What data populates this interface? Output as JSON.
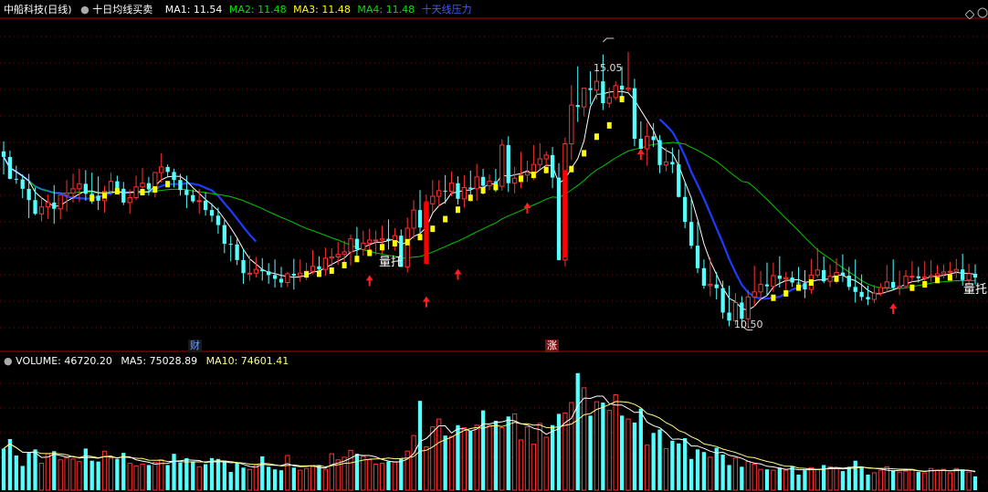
{
  "header": {
    "stock_name": "中船科技",
    "period": "(日线)",
    "indicator_name": "十日均线买卖",
    "ma1": "MA1: 11.54",
    "ma2": "MA2: 11.48",
    "ma3": "MA3: 11.48",
    "ma4": "MA4: 11.48",
    "pressure_label": "十天线压力"
  },
  "volume_header": {
    "volume": "VOLUME: 46720.20",
    "ma5": "MA5: 75028.89",
    "ma10": "MA10: 74601.41"
  },
  "markers": {
    "cai": "财",
    "zhang": "涨",
    "liangtuo_1": "量托",
    "liangtuo_2": "量托",
    "high_label": "15.05",
    "low_label": "10.50"
  },
  "colors": {
    "up": "#FF3232",
    "down": "#54FFFF",
    "ma1": "#FFFFFF",
    "ma2": "#00C800",
    "ma3": "#FFFF00",
    "pressure": "#1E3CFF",
    "grid": "#8B0000",
    "volume_ma10": "#FFFF88",
    "signal_bar": "#FF0000"
  },
  "chart_data": {
    "type": "candlestick",
    "title": "中船科技 (日线)",
    "ylim": [
      10.2,
      15.4
    ],
    "high": 15.05,
    "low": 10.5,
    "series_names": [
      "MA1",
      "MA2",
      "MA3",
      "MA4",
      "十天线压力"
    ],
    "opens": [
      13.3,
      13.21,
      12.86,
      12.85,
      12.7,
      12.52,
      12.3,
      12.41,
      12.48,
      12.38,
      12.6,
      12.63,
      12.7,
      12.78,
      12.62,
      12.59,
      12.51,
      12.66,
      12.82,
      12.7,
      12.48,
      12.56,
      12.73,
      12.79,
      12.69,
      12.96,
      13.05,
      12.97,
      12.84,
      12.68,
      12.6,
      12.5,
      12.51,
      12.36,
      12.27,
      12.12,
      11.82,
      11.81,
      11.56,
      11.35,
      11.35,
      11.41,
      11.38,
      11.32,
      11.26,
      11.2,
      11.34,
      11.31,
      11.35,
      11.38,
      11.46,
      11.41,
      11.59,
      11.61,
      11.65,
      11.69,
      11.9,
      11.73,
      11.83,
      11.88,
      11.88,
      11.9,
      11.87,
      11.95,
      11.45,
      12.07,
      12.36,
      12.08,
      12.46,
      12.58,
      12.67,
      12.66,
      12.79,
      12.54,
      12.72,
      12.7,
      12.89,
      12.75,
      12.82,
      12.74,
      13.4,
      12.79,
      12.87,
      12.92,
      12.96,
      13.09,
      13.18,
      13.24,
      12.88,
      11.56,
      13.42,
      14.04,
      14.01,
      14.31,
      14.28,
      14.42,
      14.07,
      14.16,
      14.35,
      14.29,
      14.31,
      13.5,
      13.34,
      13.54,
      13.48,
      13.08,
      13.13,
      13.09,
      12.57,
      12.17,
      11.79,
      11.43,
      11.15,
      11.17,
      11.11,
      10.72,
      10.59,
      10.88,
      10.62,
      10.97,
      11.05,
      11.17,
      11.14,
      11.31,
      11.26,
      11.28,
      11.2,
      11.19,
      11.09,
      11.32,
      11.4,
      11.22,
      11.3,
      11.36,
      11.31,
      11.13,
      11.05,
      10.97,
      10.93,
      11.03,
      11.12,
      11.21,
      11.12,
      11.14,
      11.3,
      11.3,
      11.27,
      11.29,
      11.31,
      11.34,
      11.37,
      11.38,
      11.41,
      11.24,
      11.34
    ],
    "highs": [
      13.46,
      13.31,
      13.07,
      12.93,
      12.94,
      12.72,
      12.56,
      12.61,
      12.76,
      12.61,
      12.84,
      12.94,
      13.02,
      13.0,
      12.96,
      12.9,
      12.75,
      12.96,
      12.91,
      12.81,
      12.69,
      12.91,
      13.03,
      12.89,
      12.96,
      13.27,
      13.09,
      13.02,
      12.94,
      12.91,
      12.69,
      12.7,
      12.65,
      12.47,
      12.4,
      12.2,
      11.95,
      11.9,
      11.74,
      11.64,
      11.61,
      11.59,
      11.51,
      11.57,
      11.45,
      11.37,
      11.58,
      11.57,
      11.52,
      11.72,
      11.62,
      11.76,
      11.75,
      11.85,
      11.87,
      11.97,
      12.09,
      12.03,
      12.06,
      12.03,
      12.11,
      12.21,
      12.07,
      12.05,
      12.24,
      12.52,
      12.68,
      12.61,
      12.84,
      12.84,
      12.92,
      12.98,
      12.9,
      12.92,
      12.99,
      13.1,
      13.02,
      12.93,
      13.02,
      13.49,
      13.54,
      13.05,
      13.29,
      13.15,
      13.4,
      13.43,
      13.3,
      13.37,
      13.11,
      13.52,
      14.36,
      14.66,
      14.24,
      14.58,
      14.64,
      14.85,
      14.32,
      14.42,
      14.66,
      14.89,
      14.46,
      13.78,
      13.76,
      13.75,
      13.56,
      13.36,
      13.36,
      13.33,
      12.8,
      12.57,
      12.17,
      11.57,
      11.6,
      11.37,
      11.23,
      11.15,
      11.03,
      10.98,
      11.08,
      11.47,
      11.38,
      11.52,
      11.52,
      11.62,
      11.37,
      11.38,
      11.45,
      11.4,
      11.58,
      11.75,
      11.62,
      11.49,
      11.59,
      11.65,
      11.45,
      11.57,
      11.33,
      11.15,
      11.16,
      11.19,
      11.48,
      11.57,
      11.39,
      11.4,
      11.54,
      11.45,
      11.54,
      11.56,
      11.48,
      11.49,
      11.53,
      11.58,
      11.66,
      11.5,
      11.49
    ],
    "lows": [
      12.93,
      12.85,
      12.78,
      12.55,
      12.23,
      12.28,
      12.18,
      12.22,
      12.14,
      12.21,
      12.34,
      12.48,
      12.49,
      12.51,
      12.46,
      12.36,
      12.32,
      12.6,
      12.62,
      12.44,
      12.3,
      12.52,
      12.61,
      12.59,
      12.56,
      12.8,
      12.88,
      12.72,
      12.59,
      12.39,
      12.47,
      12.3,
      12.27,
      12.17,
      11.98,
      11.67,
      11.54,
      11.48,
      11.18,
      11.23,
      11.28,
      11.23,
      11.18,
      11.12,
      11.12,
      11.13,
      11.09,
      11.21,
      11.24,
      11.33,
      11.36,
      11.31,
      11.46,
      11.48,
      11.51,
      11.47,
      11.61,
      11.63,
      11.67,
      11.64,
      11.66,
      11.73,
      11.71,
      11.57,
      11.36,
      11.9,
      11.97,
      11.93,
      12.32,
      12.42,
      12.46,
      12.58,
      12.45,
      12.4,
      12.5,
      12.51,
      12.61,
      12.68,
      12.65,
      12.67,
      12.65,
      12.63,
      12.71,
      12.81,
      12.84,
      13.01,
      13.06,
      12.71,
      11.56,
      11.46,
      13.16,
      13.77,
      13.86,
      14.05,
      14.13,
      13.96,
      14.0,
      14.12,
      14.18,
      14.24,
      13.38,
      13.26,
      13.07,
      13.37,
      12.95,
      12.98,
      12.95,
      12.56,
      12.07,
      11.74,
      11.35,
      11.1,
      10.98,
      10.93,
      10.62,
      10.5,
      10.52,
      10.47,
      10.47,
      10.81,
      10.91,
      10.99,
      11.05,
      11.12,
      11.08,
      11.13,
      11.09,
      10.95,
      11.02,
      11.28,
      11.19,
      11.13,
      11.18,
      11.21,
      11.08,
      10.88,
      10.91,
      10.84,
      10.87,
      10.99,
      11.04,
      11.08,
      11.0,
      11.11,
      11.21,
      11.2,
      11.18,
      11.21,
      11.21,
      11.27,
      11.3,
      11.27,
      11.15,
      11.17,
      11.17
    ],
    "closes": [
      13.21,
      12.86,
      12.85,
      12.7,
      12.52,
      12.3,
      12.41,
      12.48,
      12.38,
      12.6,
      12.63,
      12.7,
      12.78,
      12.62,
      12.59,
      12.51,
      12.66,
      12.82,
      12.7,
      12.48,
      12.56,
      12.73,
      12.79,
      12.69,
      12.96,
      13.05,
      12.97,
      12.84,
      12.68,
      12.6,
      12.5,
      12.51,
      12.36,
      12.27,
      12.12,
      11.82,
      11.81,
      11.56,
      11.35,
      11.35,
      11.41,
      11.38,
      11.32,
      11.26,
      11.2,
      11.34,
      11.31,
      11.35,
      11.38,
      11.46,
      11.41,
      11.59,
      11.61,
      11.65,
      11.69,
      11.9,
      11.73,
      11.83,
      11.88,
      11.88,
      11.9,
      11.87,
      11.95,
      11.45,
      12.07,
      12.36,
      12.08,
      12.46,
      12.58,
      12.67,
      12.66,
      12.79,
      12.54,
      12.72,
      12.7,
      12.89,
      12.75,
      12.82,
      12.74,
      13.4,
      12.79,
      12.87,
      12.92,
      12.96,
      13.09,
      13.18,
      13.24,
      12.88,
      11.56,
      13.42,
      14.04,
      14.01,
      14.31,
      14.28,
      14.42,
      14.07,
      14.16,
      14.35,
      14.29,
      14.31,
      13.5,
      13.34,
      13.54,
      13.48,
      13.08,
      13.13,
      13.09,
      12.57,
      12.17,
      11.79,
      11.43,
      11.15,
      11.17,
      11.11,
      10.72,
      10.59,
      10.88,
      10.62,
      10.97,
      11.05,
      11.17,
      11.14,
      11.31,
      11.26,
      11.28,
      11.2,
      11.19,
      11.09,
      11.32,
      11.4,
      11.22,
      11.3,
      11.36,
      11.31,
      11.13,
      11.05,
      10.97,
      10.93,
      11.03,
      11.12,
      11.21,
      11.12,
      11.14,
      11.3,
      11.3,
      11.27,
      11.29,
      11.31,
      11.34,
      11.37,
      11.38,
      11.41,
      11.24,
      11.34,
      11.28
    ],
    "volume": [
      48,
      59,
      40,
      28,
      43,
      47,
      31,
      42,
      45,
      35,
      37,
      36,
      33,
      48,
      34,
      33,
      45,
      37,
      36,
      43,
      31,
      28,
      30,
      29,
      32,
      35,
      29,
      42,
      32,
      37,
      33,
      27,
      30,
      37,
      36,
      34,
      21,
      32,
      26,
      24,
      29,
      39,
      27,
      24,
      23,
      40,
      26,
      23,
      25,
      27,
      29,
      24,
      42,
      35,
      38,
      46,
      42,
      39,
      35,
      30,
      31,
      33,
      33,
      37,
      45,
      63,
      103,
      50,
      73,
      82,
      63,
      62,
      75,
      72,
      68,
      75,
      92,
      75,
      80,
      72,
      85,
      88,
      58,
      73,
      53,
      77,
      61,
      75,
      88,
      89,
      101,
      135,
      118,
      86,
      102,
      101,
      92,
      110,
      86,
      82,
      78,
      94,
      52,
      66,
      70,
      48,
      57,
      54,
      60,
      36,
      47,
      44,
      38,
      49,
      41,
      29,
      37,
      27,
      33,
      30,
      24,
      24,
      23,
      26,
      23,
      28,
      18,
      23,
      26,
      24,
      29,
      27,
      25,
      22,
      27,
      34,
      27,
      18,
      20,
      23,
      27,
      23,
      21,
      22,
      24,
      21,
      20,
      25,
      23,
      24,
      20,
      25,
      24,
      21,
      16,
      22,
      20
    ]
  }
}
